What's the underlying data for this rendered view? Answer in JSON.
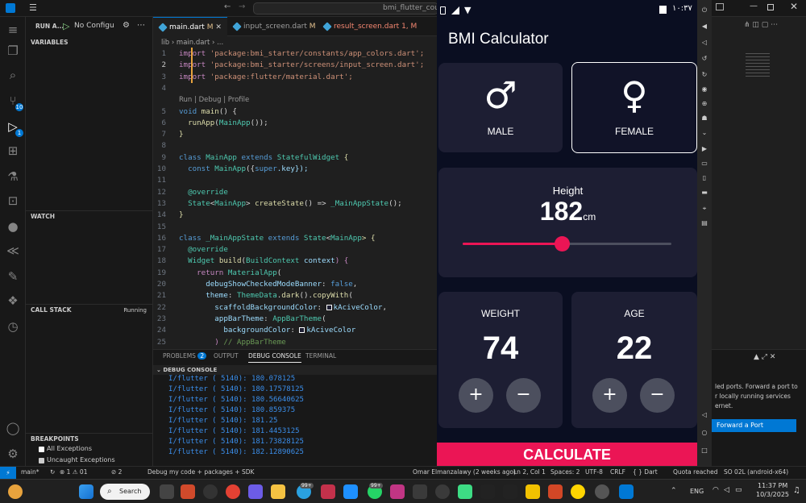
{
  "titlebar": {
    "search_text": "bmi_flutter_course"
  },
  "sidebar": {
    "run_label": "RUN A...",
    "config": "No Configu",
    "variables": "VARIABLES",
    "watch": "WATCH",
    "call_stack": "CALL STACK",
    "call_stack_status": "Running",
    "breakpoints": "BREAKPOINTS",
    "bp_all": "All Exceptions",
    "bp_uncaught": "Uncaught Exceptions"
  },
  "activity": {
    "badge_scm": "10",
    "badge_run": "1"
  },
  "editor": {
    "tabs": [
      {
        "label": "main.dart",
        "status": "M"
      },
      {
        "label": "input_screen.dart",
        "status": "M"
      },
      {
        "label": "result_screen.dart",
        "status": "1, M"
      }
    ],
    "breadcrumb": "lib  ›  main.dart  ›  ...",
    "codelens": "Run | Debug | Profile",
    "line_numbers": [
      "1",
      "2",
      "3",
      "4",
      "",
      "5",
      "6",
      "7",
      "8",
      "9",
      "10",
      "11",
      "12",
      "13",
      "14",
      "15",
      "16",
      "17",
      "18",
      "19",
      "20",
      "21",
      "22",
      "23",
      "24",
      "25"
    ]
  },
  "code": {
    "l1a": "import ",
    "l1b": "'package:bmi_starter/constants/app_colors.dart';",
    "l2a": "import ",
    "l2b": "'package:bmi_starter/screens/input_screen.dart';",
    "l3a": "import ",
    "l3b": "'package:flutter/material.dart';",
    "l5a": "void ",
    "l5b": "main",
    "l5c": "() {",
    "l6a": "  ",
    "l6b": "runApp",
    "l6c": "(",
    "l6d": "MainApp",
    "l6e": "());",
    "l7": "}",
    "l9a": "class ",
    "l9b": "MainApp ",
    "l9c": "extends ",
    "l9d": "StatefulWidget ",
    "l9e": "{",
    "l10a": "  const ",
    "l10b": "MainApp",
    "l10c": "({",
    "l10d": "super",
    "l10e": ".key});",
    "l12": "  @override",
    "l13a": "  ",
    "l13b": "State",
    "l13c": "<",
    "l13d": "MainApp",
    "l13e": "> ",
    "l13f": "createState",
    "l13g": "() => ",
    "l13h": "_MainAppState",
    "l13i": "();",
    "l14": "}",
    "l16a": "class ",
    "l16b": "_MainAppState ",
    "l16c": "extends ",
    "l16d": "State",
    "l16e": "<",
    "l16f": "MainApp",
    "l16g": "> {",
    "l17": "  @override",
    "l18a": "  ",
    "l18b": "Widget ",
    "l18c": "build",
    "l18d": "(",
    "l18e": "BuildContext ",
    "l18f": "context",
    "l18g": ") {",
    "l19a": "    ",
    "l19b": "return ",
    "l19c": "MaterialApp",
    "l19d": "(",
    "l20a": "      ",
    "l20b": "debugShowCheckedModeBanner",
    "l20c": ": ",
    "l20d": "false",
    ",l20e": ",",
    "l21a": "      ",
    "l21b": "theme",
    "l21c": ": ",
    "l21d": "ThemeData",
    "l21e": ".",
    "l21f": "dark",
    "l21g": "().",
    "l21h": "copyWith",
    "l21i": "(",
    "l22a": "        ",
    "l22b": "scaffoldBackgroundColor",
    "l22c": ": ",
    "l22d": "kAciveColor",
    ",l22e": ",",
    "l23a": "        ",
    "l23b": "appBarTheme",
    "l23c": ": ",
    "l23d": "AppBarTheme",
    "l23e": "(",
    "l24a": "          ",
    "l24b": "backgroundColor",
    "l24c": ": ",
    "l24d": "kAciveColor",
    "l25a": "        ) ",
    "l25b": "// AppBarTheme"
  },
  "panel": {
    "tabs": [
      "PROBLEMS",
      "OUTPUT",
      "DEBUG CONSOLE",
      "TERMINAL"
    ],
    "problems_count": "2",
    "header": "DEBUG CONSOLE",
    "logs": [
      "I/flutter ( 5140): 180.078125",
      "I/flutter ( 5140): 180.17578125",
      "I/flutter ( 5140): 180.56640625",
      "I/flutter ( 5140): 180.859375",
      "I/flutter ( 5140): 181.25",
      "I/flutter ( 5140): 181.4453125",
      "I/flutter ( 5140): 181.73828125",
      "I/flutter ( 5140): 182.12890625"
    ]
  },
  "phone": {
    "time": "١٠:٣٧",
    "app_title": "BMI Calculator",
    "male_symbol": "♂",
    "male": "MALE",
    "female_symbol": "♀",
    "female": "FEMALE",
    "height_label": "Height",
    "height_value": "182",
    "height_unit": "cm",
    "height_fraction": 0.475,
    "weight_label": "WEIGHT",
    "weight_value": "74",
    "age_label": "AGE",
    "age_value": "22",
    "plus": "+",
    "minus": "−",
    "calculate": "CALCULATE",
    "accent": "#eb1555",
    "card": "#1d1e33",
    "bg": "#0a0e21"
  },
  "rightpane": {
    "ports_text_1": "led ports. Forward a port to",
    "ports_text_2": "r locally running services",
    "ports_text_3": "ernet.",
    "forward_button": "Forward a Port"
  },
  "status": {
    "branch": "main*",
    "sync": "↻",
    "errors": "⊗ 1  ⚠ 01",
    "ports": "⊘ 2",
    "debug": "Debug my code + packages + SDK",
    "blame": "Omar Elmanzalawy (2 weeks ago)",
    "cursor": "Ln 2, Col 1",
    "spaces": "Spaces: 2",
    "encoding": "UTF-8",
    "eol": "CRLF",
    "lang": "{ } Dart",
    "quota": "Quota reached",
    "device": "SO 02L (android-x64)"
  },
  "taskbar": {
    "search": "Search",
    "lang": "ENG",
    "time": "11:37 PM",
    "date": "10/3/2025",
    "badge1": "99+",
    "badge2": "99+"
  }
}
